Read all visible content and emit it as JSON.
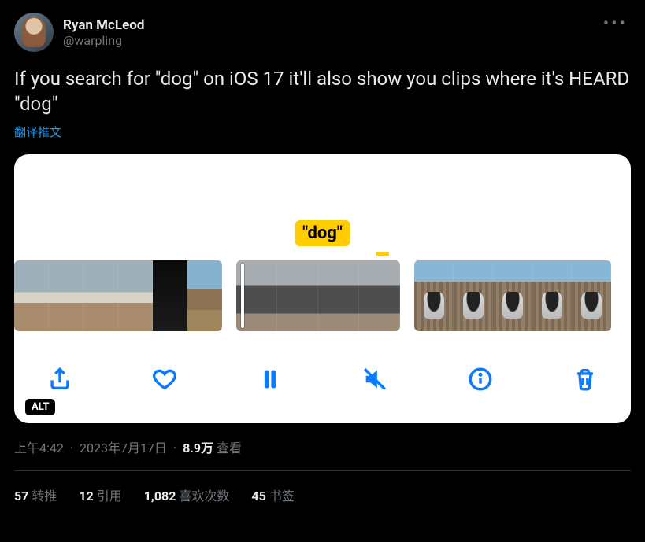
{
  "author": {
    "display_name": "Ryan McLeod",
    "handle": "@warpling"
  },
  "tweet_text": "If you search for \"dog\" on iOS 17 it'll also show you clips where it's HEARD \"dog\"",
  "translate_label": "翻译推文",
  "media": {
    "tooltip_text": "\"dog\"",
    "alt_badge": "ALT",
    "toolbar_icons": [
      "share",
      "heart",
      "pause",
      "mute",
      "info",
      "trash"
    ]
  },
  "meta": {
    "time": "上午4:42",
    "date": "2023年7月17日",
    "views_number": "8.9万",
    "views_label": "查看"
  },
  "stats": {
    "retweets": {
      "count": "57",
      "label": "转推"
    },
    "quotes": {
      "count": "12",
      "label": "引用"
    },
    "likes": {
      "count": "1,082",
      "label": "喜欢次数"
    },
    "bookmarks": {
      "count": "45",
      "label": "书签"
    }
  }
}
